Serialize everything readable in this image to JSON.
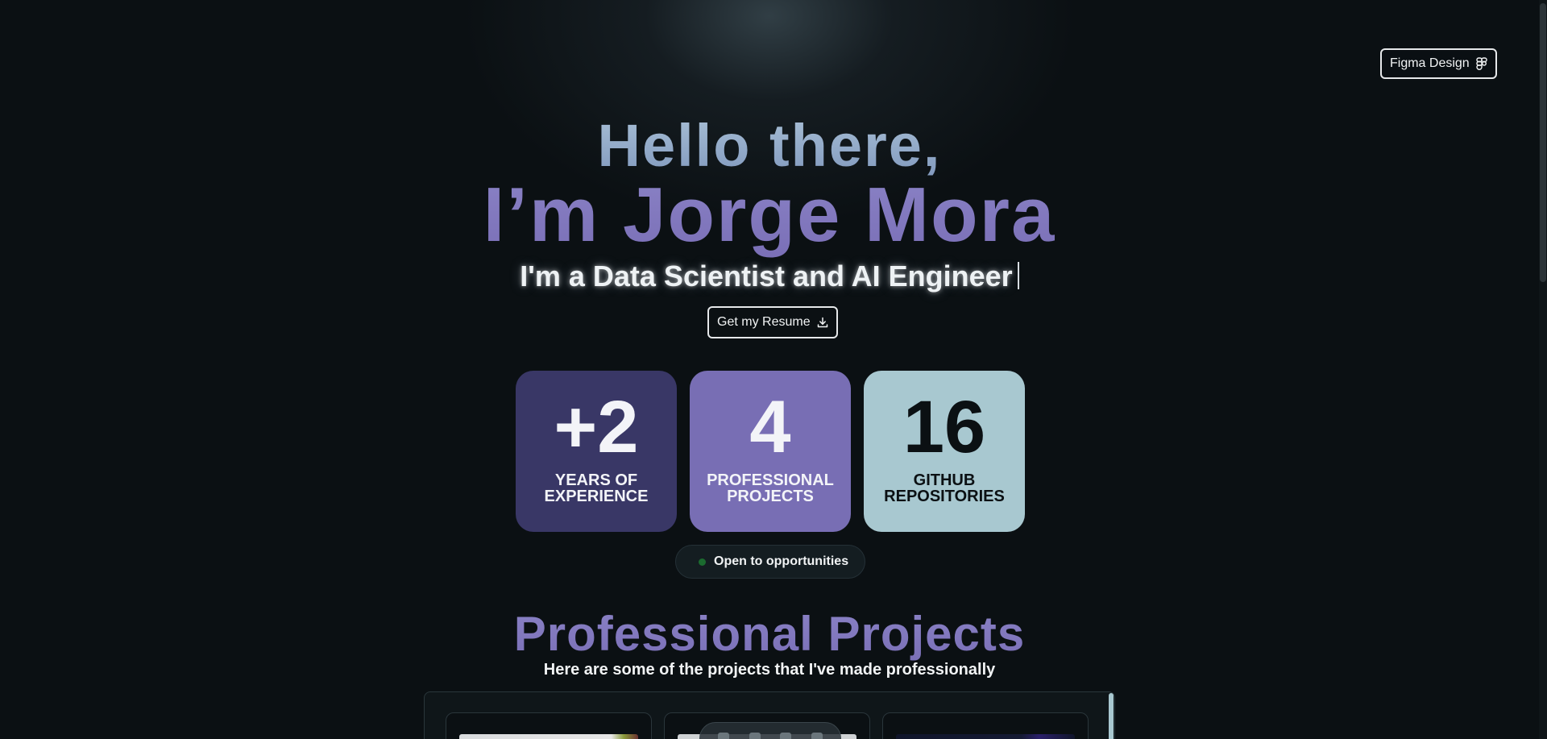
{
  "header": {
    "figma_label": "Figma Design",
    "figma_icon": "figma-icon"
  },
  "hero": {
    "greeting": "Hello there,",
    "name": "I’m Jorge Mora",
    "role": "I'm a Data Scientist and AI Engineer",
    "resume_label": "Get my Resume",
    "resume_icon": "download-icon"
  },
  "stats": [
    {
      "value": "+2",
      "label": "YEARS OF EXPERIENCE",
      "color": "#393766"
    },
    {
      "value": "4",
      "label": "PROFESSIONAL PROJECTS",
      "color": "#786eb4"
    },
    {
      "value": "16",
      "label": "GITHUB REPOSITORIES",
      "color": "#a8c8d0"
    }
  ],
  "status": {
    "label": "Open to opportunities",
    "dot_color": "#1b6b2f"
  },
  "projects": {
    "title": "Professional Projects",
    "subtitle": "Here are some of the projects that I've made professionally"
  },
  "colors": {
    "background": "#0b1013",
    "accent_purple": "#786eb4",
    "accent_teal": "#a8c8d0"
  }
}
